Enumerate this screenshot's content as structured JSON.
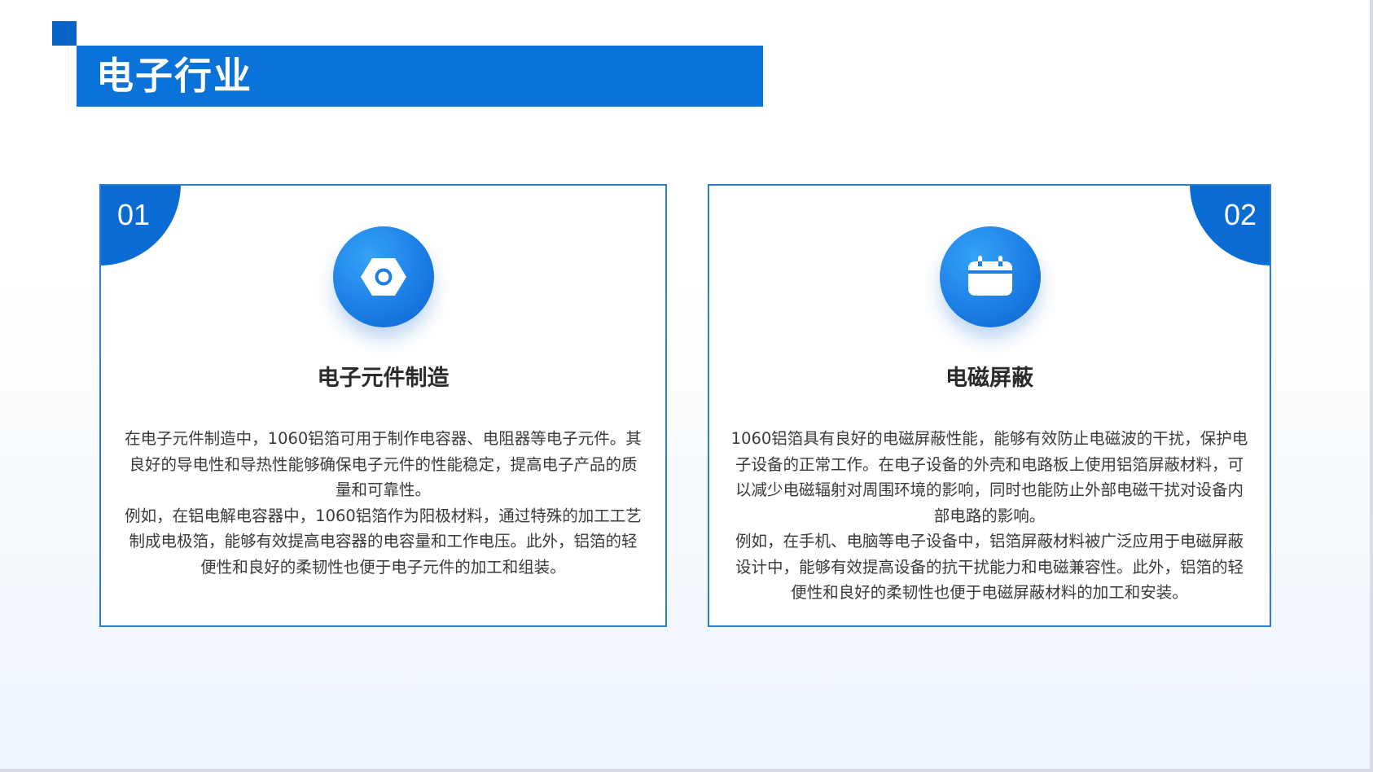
{
  "title": "电子行业",
  "cards": [
    {
      "number": "01",
      "icon": "hex-nut-icon",
      "heading": "电子元件制造",
      "paragraphs": [
        "在电子元件制造中，1060铝箔可用于制作电容器、电阻器等电子元件。其良好的导电性和导热性能够确保电子元件的性能稳定，提高电子产品的质量和可靠性。",
        "例如，在铝电解电容器中，1060铝箔作为阳极材料，通过特殊的加工工艺制成电极箔，能够有效提高电容器的电容量和工作电压。此外，铝箔的轻便性和良好的柔韧性也便于电子元件的加工和组装。"
      ]
    },
    {
      "number": "02",
      "icon": "calendar-icon",
      "heading": "电磁屏蔽",
      "paragraphs": [
        "1060铝箔具有良好的电磁屏蔽性能，能够有效防止电磁波的干扰，保护电子设备的正常工作。在电子设备的外壳和电路板上使用铝箔屏蔽材料，可以减少电磁辐射对周围环境的影响，同时也能防止外部电磁干扰对设备内部电路的影响。",
        "例如，在手机、电脑等电子设备中，铝箔屏蔽材料被广泛应用于电磁屏蔽设计中，能够有效提高设备的抗干扰能力和电磁兼容性。此外，铝箔的轻便性和良好的柔韧性也便于电磁屏蔽材料的加工和安装。"
      ]
    }
  ],
  "colors": {
    "accent": "#0a72d9",
    "accent_dark": "#0a64c8",
    "border": "#2a7fcf",
    "text": "#3a3a3a"
  }
}
